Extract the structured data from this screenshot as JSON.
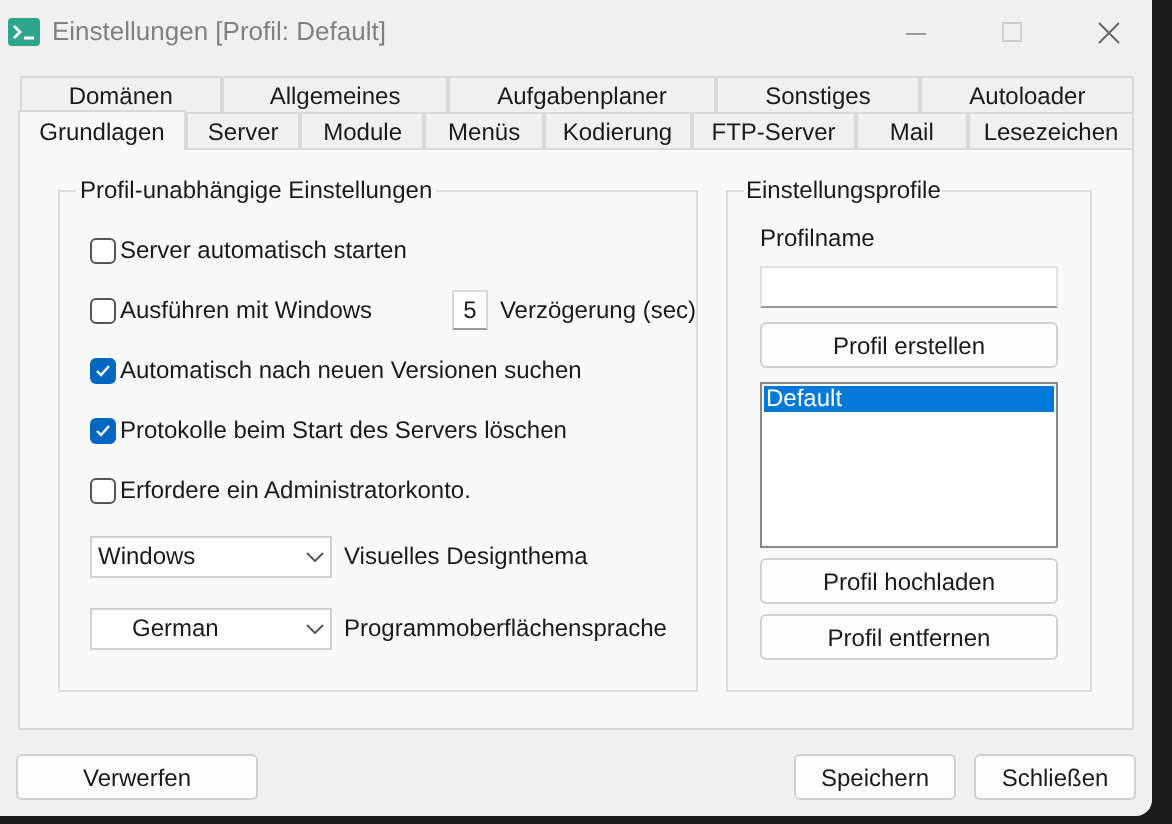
{
  "window": {
    "title": "Einstellungen [Profil: Default]"
  },
  "tab_rows": [
    [
      {
        "label": "Domänen",
        "selected": false
      },
      {
        "label": "Allgemeines",
        "selected": false
      },
      {
        "label": "Aufgabenplaner",
        "selected": false
      },
      {
        "label": "Sonstiges",
        "selected": false
      },
      {
        "label": "Autoloader",
        "selected": false
      }
    ],
    [
      {
        "label": "Grundlagen",
        "selected": true
      },
      {
        "label": "Server",
        "selected": false
      },
      {
        "label": "Module",
        "selected": false
      },
      {
        "label": "Menüs",
        "selected": false
      },
      {
        "label": "Kodierung",
        "selected": false
      },
      {
        "label": "FTP-Server",
        "selected": false
      },
      {
        "label": "Mail",
        "selected": false
      },
      {
        "label": "Lesezeichen",
        "selected": false
      }
    ]
  ],
  "general_group": {
    "title": "Profil-unabhängige Einstellungen",
    "options": [
      {
        "kind": "checkbox",
        "label": "Server automatisch starten",
        "checked": false
      },
      {
        "kind": "checkbox_delay",
        "label": "Ausführen mit Windows",
        "checked": false,
        "value": "5",
        "suffix": "Verzögerung (sec)"
      },
      {
        "kind": "checkbox",
        "label": "Automatisch nach neuen Versionen suchen",
        "checked": true
      },
      {
        "kind": "checkbox",
        "label": "Protokolle beim Start des Servers löschen",
        "checked": true
      },
      {
        "kind": "checkbox",
        "label": "Erfordere ein Administratorkonto.",
        "checked": false
      },
      {
        "kind": "dropdown",
        "selection": "Windows",
        "description": "Visuelles Designthema"
      },
      {
        "kind": "dropdown",
        "selection": "German",
        "description": "Programmoberflächensprache"
      }
    ]
  },
  "profiles_group": {
    "title": "Einstellungsprofile",
    "name_label": "Profilname",
    "create_button": "Profil erstellen",
    "profiles": [
      {
        "label": "Default",
        "selected": true
      }
    ],
    "buttons": [
      "Profil hochladen",
      "Profil entfernen"
    ]
  },
  "footer": {
    "discard": "Verwerfen",
    "buttons": [
      "Speichern",
      "Schließen"
    ]
  }
}
